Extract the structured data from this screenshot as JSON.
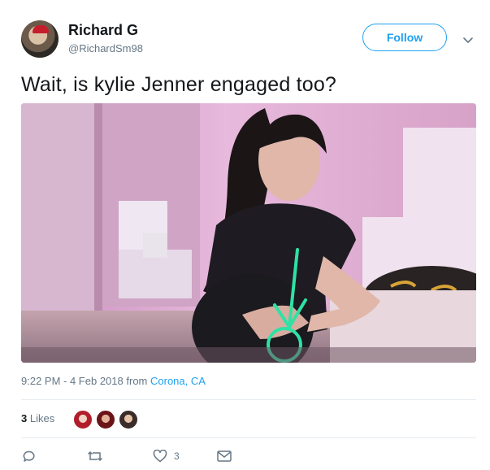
{
  "author": {
    "name": "Richard G",
    "handle": "@RichardSm98"
  },
  "follow_label": "Follow",
  "tweet": {
    "text": "Wait, is kylie Jenner engaged too?",
    "time": "9:22 PM - 4 Feb 2018",
    "from_label": "from",
    "location": "Corona, CA"
  },
  "likes": {
    "count": "3",
    "label": "Likes"
  },
  "actions": {
    "like_count": "3"
  },
  "colors": {
    "accent": "#1da1f2",
    "secondary_text": "#657786",
    "annotation": "#2ee2a5"
  },
  "icons": [
    "chevron-down-icon",
    "reply-icon",
    "retweet-icon",
    "heart-icon",
    "message-icon"
  ]
}
